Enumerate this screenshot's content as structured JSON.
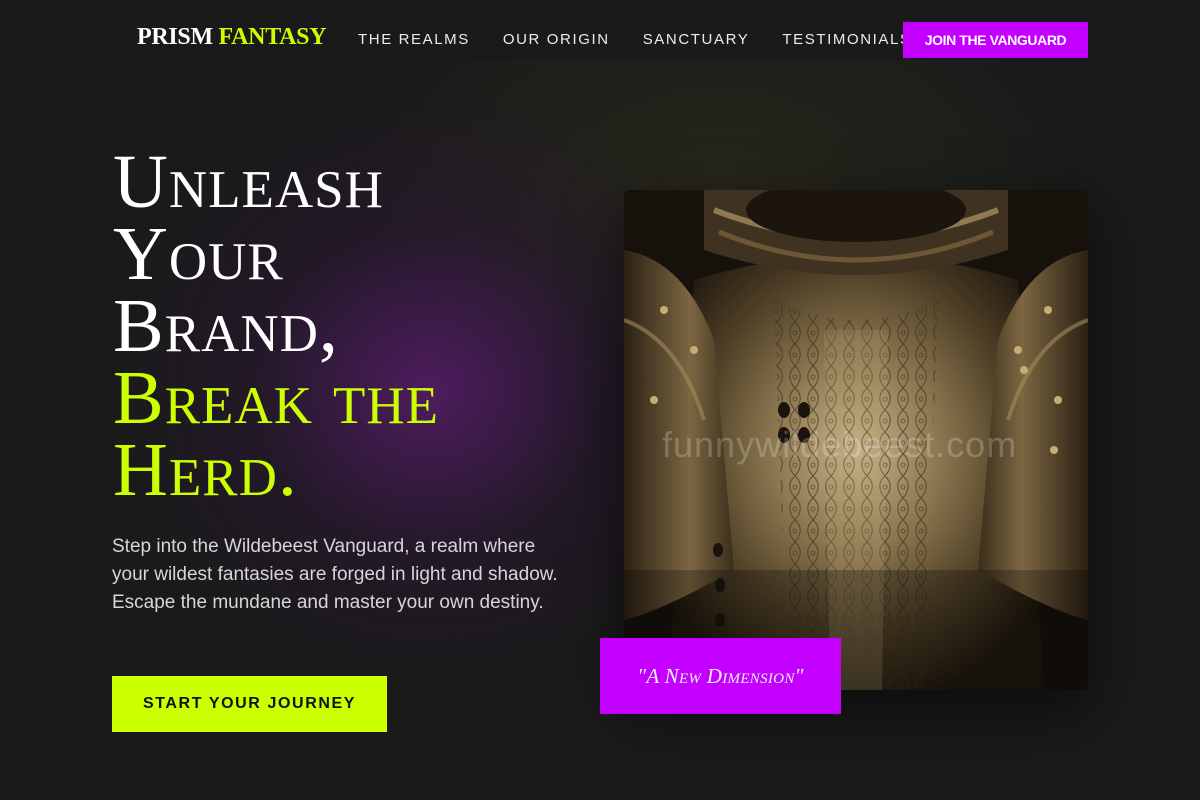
{
  "nav": {
    "logo_part1": "PRISM",
    "logo_part2": "FANTASY",
    "links": [
      {
        "label": "THE REALMS"
      },
      {
        "label": "OUR ORIGIN"
      },
      {
        "label": "SANCTUARY"
      },
      {
        "label": "TESTIMONIALS"
      }
    ],
    "cta_label": "JOIN THE VANGUARD"
  },
  "hero": {
    "headline_lines": [
      {
        "text": "Unleash",
        "color": "white"
      },
      {
        "text": "Your",
        "color": "white"
      },
      {
        "text": "Brand,",
        "color": "white"
      },
      {
        "text": "Break the",
        "color": "lime"
      },
      {
        "text": "Herd.",
        "color": "lime"
      }
    ],
    "description": "Step into the Wildebeest Vanguard, a realm where your wildest fantasies are forged in light and shadow. Escape the mundane and master your own destiny.",
    "cta_label": "START YOUR JOURNEY",
    "image_watermark": "funnywildebeest.com",
    "image_caption": "\"A New Dimension\""
  },
  "colors": {
    "background": "#1a1a1a",
    "accent_purple": "#c300ff",
    "accent_lime": "#ccff00"
  }
}
